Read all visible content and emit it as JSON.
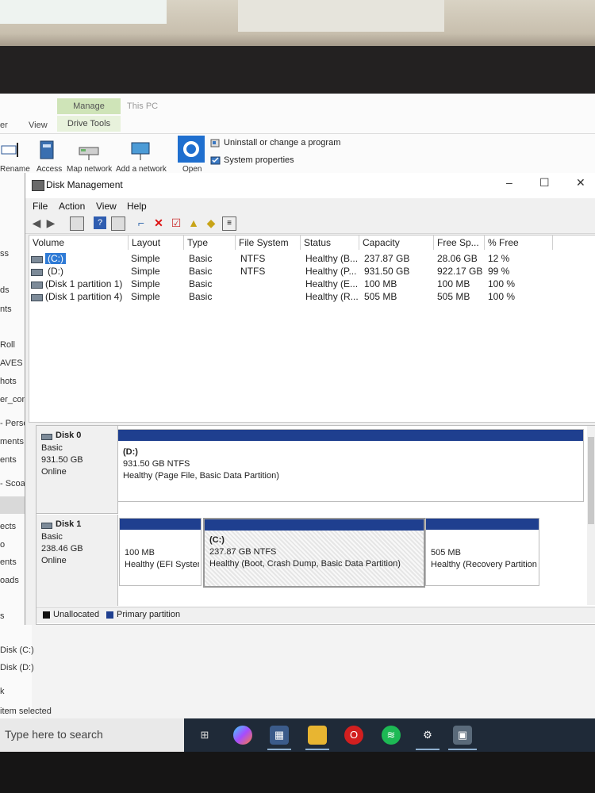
{
  "ribbon": {
    "tabs": {
      "manage": "Manage",
      "thispc": "This PC",
      "er": "er",
      "view": "View",
      "drive_tools": "Drive Tools"
    },
    "buttons": {
      "rename": "Rename",
      "access": "Access",
      "map_network": "Map network",
      "add_network": "Add a network",
      "open": "Open"
    },
    "links": {
      "uninstall": "Uninstall or change a program",
      "system_properties": "System properties"
    }
  },
  "leftnav": [
    "ss",
    "ds",
    "nts",
    "Roll",
    "AVES TA",
    "hots",
    "er_com",
    "- Perso",
    "ments",
    "ents",
    "- Scoala",
    "ects",
    "o",
    "ents",
    "oads",
    "s",
    "Disk (C:)",
    "Disk (D:)",
    "k",
    "item selected"
  ],
  "dm": {
    "title": "Disk Management",
    "menu": [
      "File",
      "Action",
      "View",
      "Help"
    ],
    "columns": [
      "Volume",
      "Layout",
      "Type",
      "File System",
      "Status",
      "Capacity",
      "Free Sp...",
      "% Free"
    ],
    "volumes": [
      {
        "volume": "(C:)",
        "layout": "Simple",
        "type": "Basic",
        "fs": "NTFS",
        "status": "Healthy (B...",
        "capacity": "237.87 GB",
        "free": "28.06 GB",
        "pct": "12 %"
      },
      {
        "volume": "(D:)",
        "layout": "Simple",
        "type": "Basic",
        "fs": "NTFS",
        "status": "Healthy (P...",
        "capacity": "931.50 GB",
        "free": "922.17 GB",
        "pct": "99 %"
      },
      {
        "volume": "(Disk 1 partition 1)",
        "layout": "Simple",
        "type": "Basic",
        "fs": "",
        "status": "Healthy (E...",
        "capacity": "100 MB",
        "free": "100 MB",
        "pct": "100 %"
      },
      {
        "volume": "(Disk 1 partition 4)",
        "layout": "Simple",
        "type": "Basic",
        "fs": "",
        "status": "Healthy (R...",
        "capacity": "505 MB",
        "free": "505 MB",
        "pct": "100 %"
      }
    ],
    "disk0": {
      "name": "Disk 0",
      "type": "Basic",
      "size": "931.50 GB",
      "state": "Online",
      "partition": {
        "label": "(D:)",
        "size": "931.50 GB NTFS",
        "status": "Healthy (Page File, Basic Data Partition)"
      }
    },
    "disk1": {
      "name": "Disk 1",
      "type": "Basic",
      "size": "238.46 GB",
      "state": "Online",
      "partitions": [
        {
          "label": "",
          "size": "100 MB",
          "status": "Healthy (EFI System Partition)"
        },
        {
          "label": "(C:)",
          "size": "237.87 GB NTFS",
          "status": "Healthy (Boot, Crash Dump, Basic Data Partition)"
        },
        {
          "label": "",
          "size": "505 MB",
          "status": "Healthy (Recovery Partition)"
        }
      ]
    },
    "legend": {
      "unallocated": "Unallocated",
      "primary": "Primary partition"
    },
    "colors": {
      "primary": "#1f3f8f",
      "unallocated": "#111111",
      "selection": "#2f7bd6"
    }
  },
  "taskbar": {
    "search_placeholder": "Type here to search"
  }
}
